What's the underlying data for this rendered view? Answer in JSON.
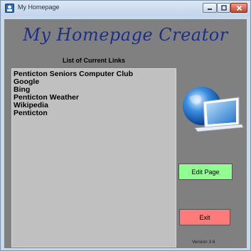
{
  "window": {
    "title": "My Homepage"
  },
  "header": {
    "logo_text": "My Homepage Creator"
  },
  "links": {
    "heading": "List of Current Links",
    "items": [
      "Penticton Seniors Computer Club",
      "Google",
      "Bing",
      "Penticton Weather",
      "Wikipedia",
      "Penticton"
    ]
  },
  "actions": {
    "edit_label": "Edit Page",
    "exit_label": "Exit"
  },
  "footer": {
    "version": "Version 3.6"
  },
  "colors": {
    "edit_button": "#8fff8f",
    "exit_button": "#ff7b7b",
    "logo": "#1c2f8a",
    "client_bg": "#808080",
    "list_bg": "#c0c0c0"
  },
  "icons": [
    "app-icon",
    "minimize-icon",
    "maximize-icon",
    "close-icon",
    "globe-laptop-icon"
  ]
}
